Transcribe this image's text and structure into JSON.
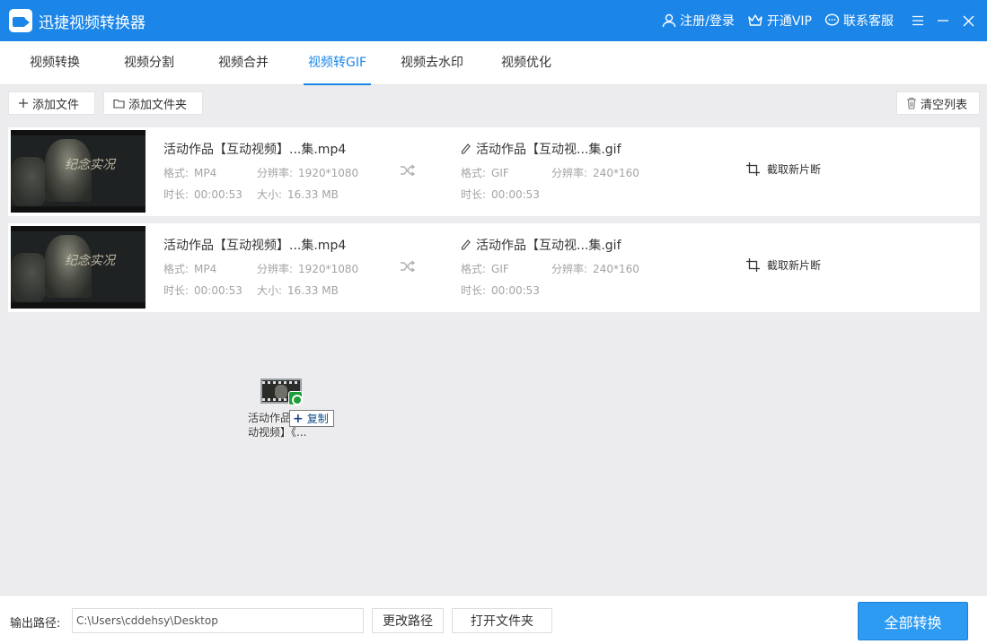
{
  "app": {
    "title": "迅捷视频转换器",
    "register_login": "注册/登录",
    "vip": "开通VIP",
    "support": "联系客服"
  },
  "tabs": [
    {
      "label": "视频转换"
    },
    {
      "label": "视频分割"
    },
    {
      "label": "视频合并"
    },
    {
      "label": "视频转GIF",
      "active": true
    },
    {
      "label": "视频去水印"
    },
    {
      "label": "视频优化"
    }
  ],
  "toolbar": {
    "add_file": "添加文件",
    "add_folder": "添加文件夹",
    "clear_list": "清空列表"
  },
  "files": [
    {
      "thumb_text": "纪念实况",
      "src_name": "活动作品【互动视频】...集.mp4",
      "src_format_label": "格式:",
      "src_format": "MP4",
      "src_res_label": "分辨率:",
      "src_res": "1920*1080",
      "src_dur_label": "时长:",
      "src_dur": "00:00:53",
      "src_size_label": "大小:",
      "src_size": "16.33 MB",
      "dst_name": "活动作品【互动视...集.gif",
      "dst_format_label": "格式:",
      "dst_format": "GIF",
      "dst_res_label": "分辨率:",
      "dst_res": "240*160",
      "dst_dur_label": "时长:",
      "dst_dur": "00:00:53",
      "clip_label": "截取新片断"
    },
    {
      "thumb_text": "纪念实况",
      "src_name": "活动作品【互动视频】...集.mp4",
      "src_format_label": "格式:",
      "src_format": "MP4",
      "src_res_label": "分辨率:",
      "src_res": "1920*1080",
      "src_dur_label": "时长:",
      "src_dur": "00:00:53",
      "src_size_label": "大小:",
      "src_size": "16.33 MB",
      "dst_name": "活动作品【互动视...集.gif",
      "dst_format_label": "格式:",
      "dst_format": "GIF",
      "dst_res_label": "分辨率:",
      "dst_res": "240*160",
      "dst_dur_label": "时长:",
      "dst_dur": "00:00:53",
      "clip_label": "截取新片断"
    }
  ],
  "drag": {
    "label_line1": "活动作品",
    "label_line2": "动视频】《...",
    "copy_label": "复制"
  },
  "bottom": {
    "output_label": "输出路径:",
    "output_path": "C:\\Users\\cddehsy\\Desktop",
    "change_path": "更改路径",
    "open_folder": "打开文件夹",
    "convert_all": "全部转换"
  },
  "colors": {
    "brand": "#1b86e8",
    "primary_button": "#2e9bf3"
  }
}
